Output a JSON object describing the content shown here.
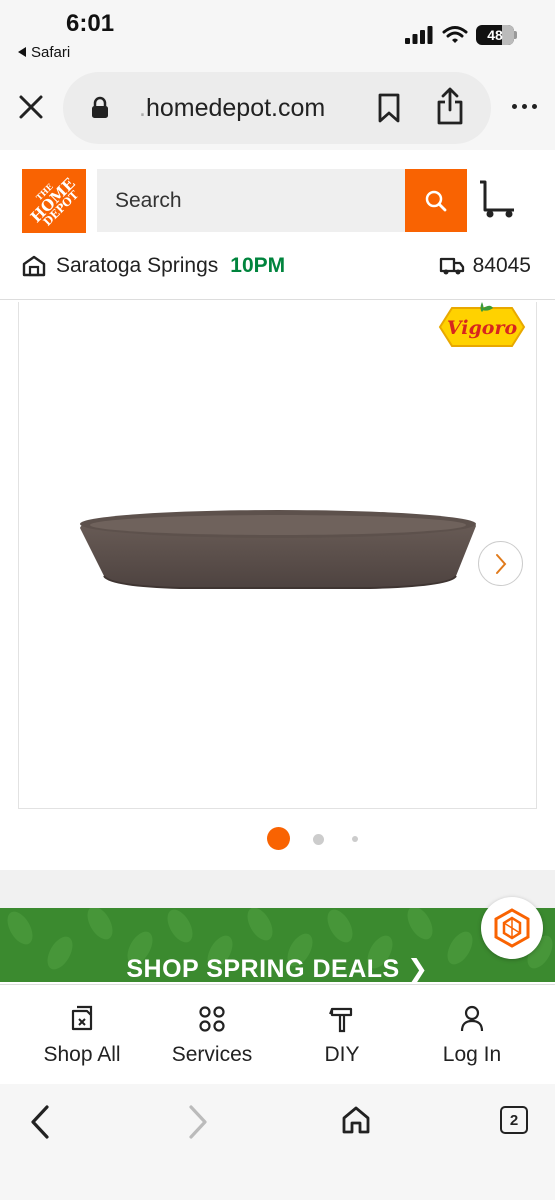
{
  "status_bar": {
    "time": "6:01",
    "back_app": "Safari",
    "battery": "48"
  },
  "browser": {
    "url_faded": ".",
    "url_domain": "homedepot.com",
    "tab_count": "2"
  },
  "header": {
    "logo_text": [
      "THE",
      "HOME",
      "DEPOT"
    ],
    "search_placeholder": "Search",
    "store_name": "Saratoga Springs",
    "store_hours": "10PM",
    "zip": "84045"
  },
  "product": {
    "brand": "Vigoro",
    "image_icon": "plant-saucer-image",
    "carousel": {
      "total": 3,
      "active": 1
    }
  },
  "promo": {
    "text": "SHOP SPRING DEALS ❯"
  },
  "tabs": [
    {
      "label": "Shop All",
      "icon": "shop-all-icon"
    },
    {
      "label": "Services",
      "icon": "services-icon"
    },
    {
      "label": "DIY",
      "icon": "diy-hammer-icon"
    },
    {
      "label": "Log In",
      "icon": "user-icon"
    }
  ],
  "colors": {
    "brand_orange": "#f96302",
    "store_hours_green": "#00843d",
    "promo_green": "#3b8a2f"
  }
}
